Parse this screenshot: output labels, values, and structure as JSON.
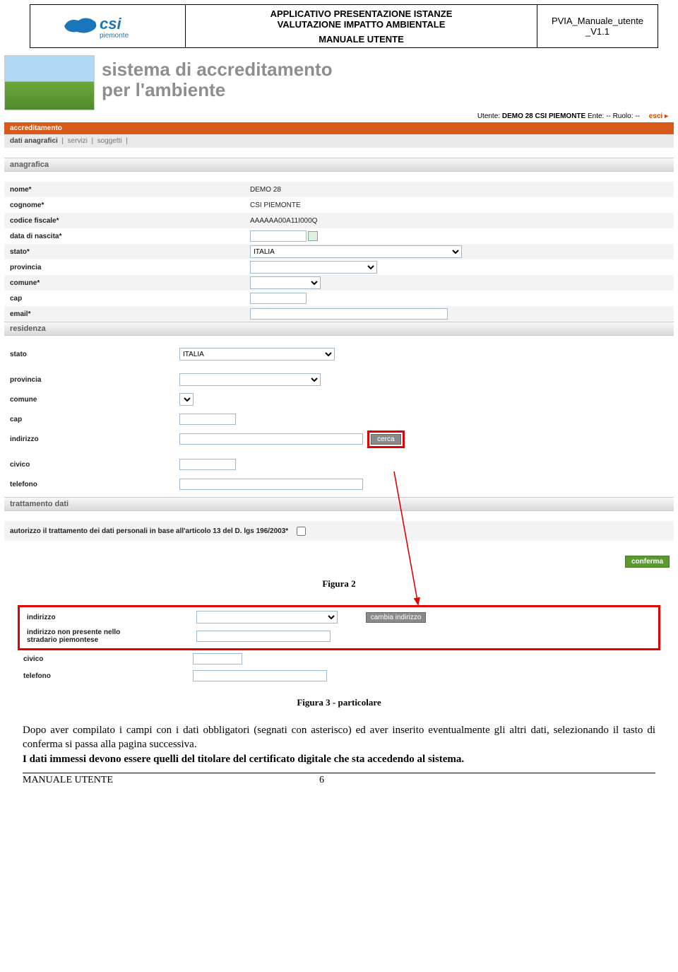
{
  "doc_header": {
    "title1": "APPLICATIVO  PRESENTAZIONE ISTANZE",
    "title2": "VALUTAZIONE IMPATTO AMBIENTALE",
    "title3": "MANUALE UTENTE",
    "ref1": "PVIA_Manuale_utente",
    "ref2": "_V1.1",
    "logo_main": "csi",
    "logo_sub": "piemonte"
  },
  "hero": {
    "line1": "sistema di accreditamento",
    "line2": "per l'ambiente"
  },
  "userbar": {
    "utente_label": "Utente:",
    "utente_value": "DEMO 28 CSI PIEMONTE",
    "ente_label": "Ente:",
    "ente_value": "--",
    "ruolo_label": "Ruolo:",
    "ruolo_value": "--",
    "esci": "esci",
    "esci_arrow": "▸"
  },
  "orange_bar": "accreditamento",
  "tabs": {
    "t1": "dati anagrafici",
    "t2": "servizi",
    "t3": "soggetti",
    "sep": "|"
  },
  "sections": {
    "anagrafica": "anagrafica",
    "residenza": "residenza",
    "trattamento": "trattamento dati"
  },
  "anagrafica": {
    "nome_label": "nome*",
    "nome_value": "DEMO 28",
    "cognome_label": "cognome*",
    "cognome_value": "CSI PIEMONTE",
    "cf_label": "codice fiscale*",
    "cf_value": "AAAAAA00A11I000Q",
    "nascita_label": "data di nascita*",
    "stato_label": "stato*",
    "stato_value": "ITALIA",
    "provincia_label": "provincia",
    "comune_label": "comune*",
    "cap_label": "cap",
    "email_label": "email*"
  },
  "residenza": {
    "stato_label": "stato",
    "stato_value": "ITALIA",
    "provincia_label": "provincia",
    "comune_label": "comune",
    "cap_label": "cap",
    "indirizzo_label": "indirizzo",
    "cerca_btn": "cerca",
    "civico_label": "civico",
    "telefono_label": "telefono"
  },
  "trattamento": {
    "label": "autorizzo il trattamento dei dati personali in base all'articolo 13 del D. lgs 196/2003*"
  },
  "buttons": {
    "conferma": "conferma",
    "cambia_indirizzo": "cambia indirizzo"
  },
  "captions": {
    "fig2": "Figura 2",
    "fig3": "Figura 3 - particolare"
  },
  "detail": {
    "indirizzo_label": "indirizzo",
    "nonpres_label1": "indirizzo non presente nello",
    "nonpres_label2": "stradario piemontese",
    "civico_label": "civico",
    "telefono_label": "telefono"
  },
  "body": {
    "p1": "Dopo aver compilato i campi con i dati obbligatori (segnati con asterisco) ed aver inserito eventualmente gli altri dati, selezionando il tasto di conferma si passa alla pagina successiva.",
    "p2a": "I dati immessi devono essere quelli del titolare del certificato digitale che sta accedendo al sistema.",
    "footer_left": "MANUALE UTENTE",
    "footer_page": "6"
  }
}
